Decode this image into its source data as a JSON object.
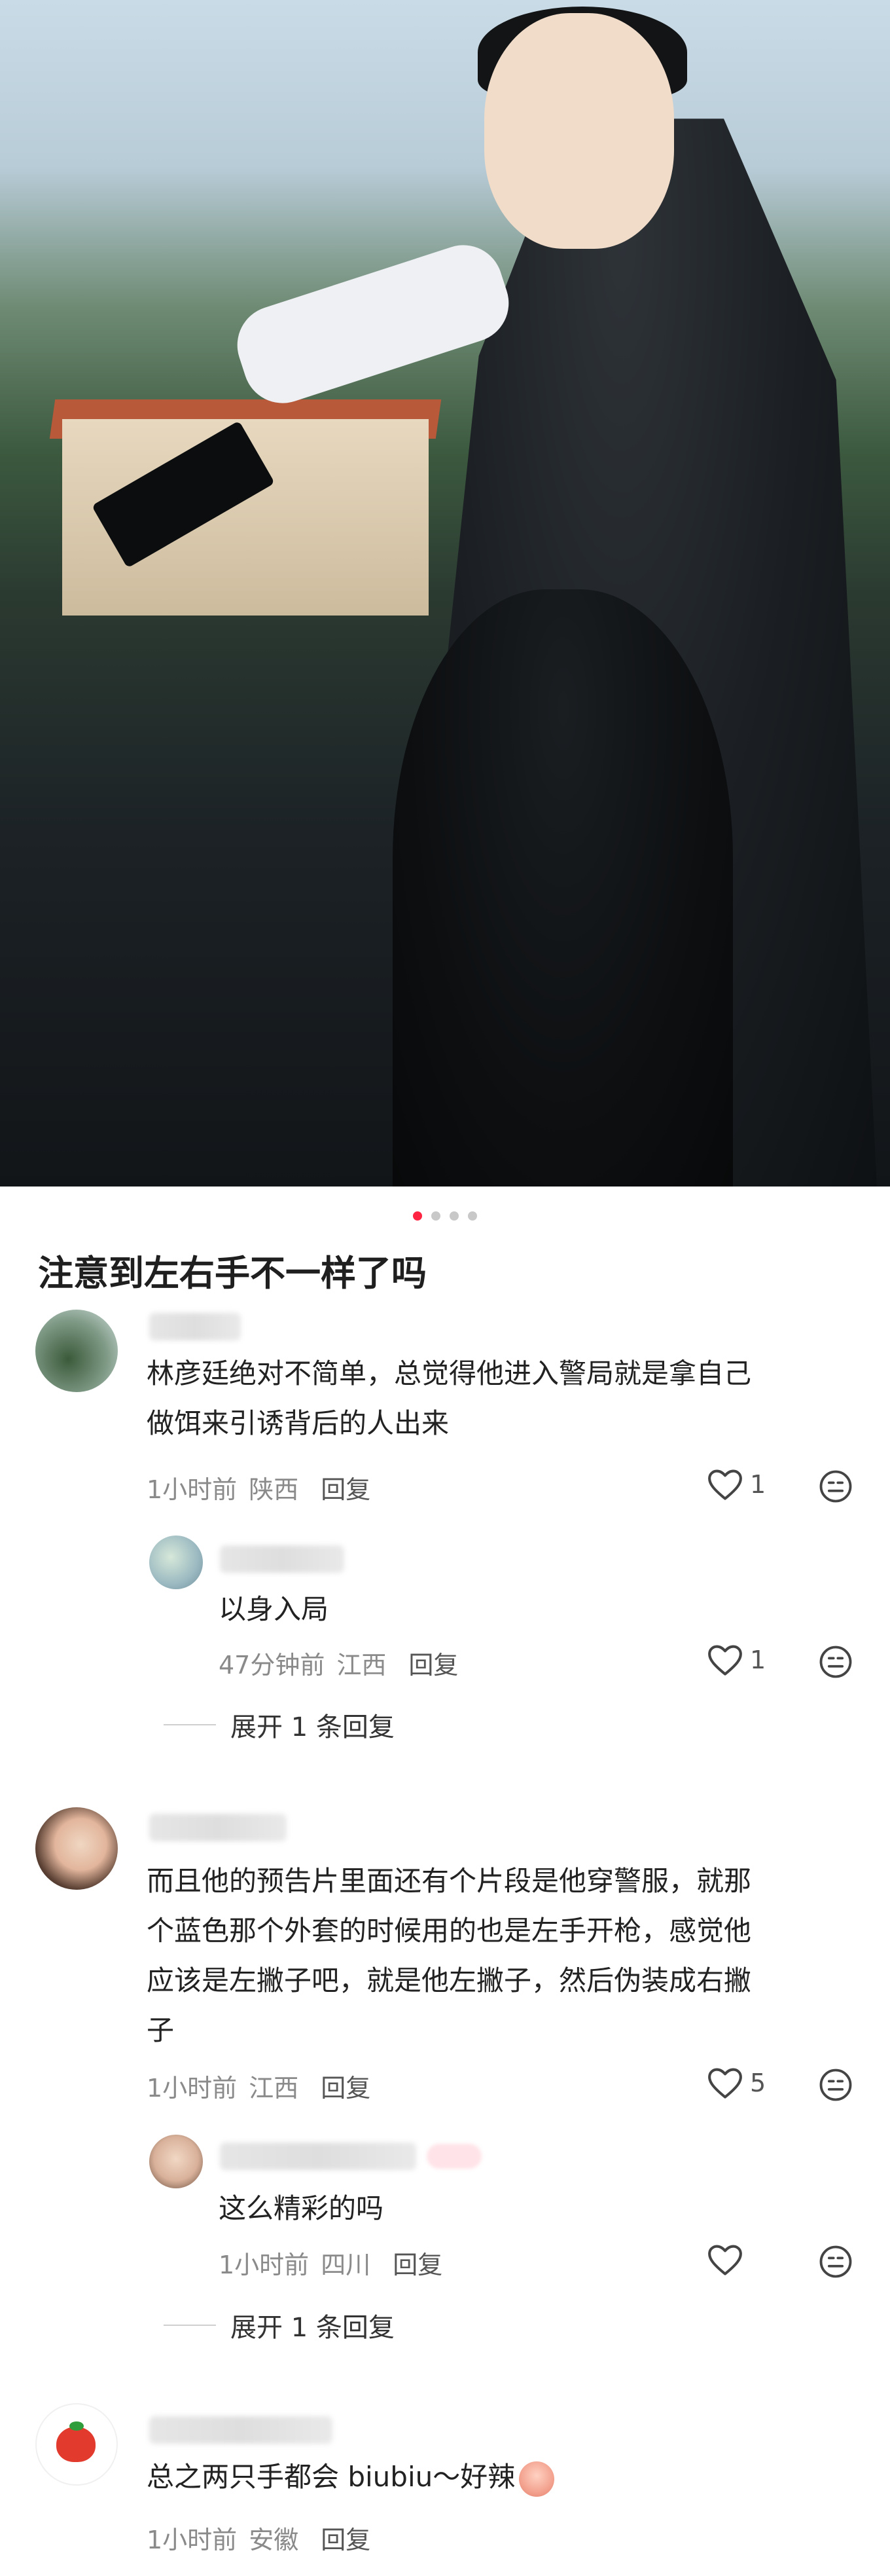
{
  "post": {
    "title": "注意到左右手不一样了吗",
    "carousel": {
      "total": 4,
      "active_index": 0
    }
  },
  "colors": {
    "accent": "#ff2442",
    "meta_text": "#8a8a8a",
    "body_text": "#222222"
  },
  "icons": {
    "like": "heart-outline-icon",
    "emoji": "emoji-face-icon",
    "avatar_tomato": "tomato-icon",
    "inline_emoji": "spicy-face-emoji"
  },
  "comments": [
    {
      "text_line1": "林彦廷绝对不简单，总觉得他进入警局就是拿自己",
      "text_line2": "做饵来引诱背后的人出来",
      "time": "1小时前",
      "location": "陕西",
      "reply_label": "回复",
      "likes": "1",
      "replies": [
        {
          "text": "以身入局",
          "time": "47分钟前",
          "location": "江西",
          "reply_label": "回复",
          "likes": "1"
        }
      ],
      "expand_label": "展开 1 条回复"
    },
    {
      "text_line1": "而且他的预告片里面还有个片段是他穿警服，就那",
      "text_line2": "个蓝色那个外套的时候用的也是左手开枪，感觉他",
      "text_line3": "应该是左撇子吧，就是他左撇子，然后伪装成右撇",
      "text_line4": "子",
      "time": "1小时前",
      "location": "江西",
      "reply_label": "回复",
      "likes": "5",
      "replies": [
        {
          "text": "这么精彩的吗",
          "time": "1小时前",
          "location": "四川",
          "reply_label": "回复",
          "likes": ""
        }
      ],
      "expand_label": "展开 1 条回复"
    },
    {
      "text": "总之两只手都会 biubiu～好辣",
      "time": "1小时前",
      "location": "安徽",
      "reply_label": "回复"
    }
  ]
}
